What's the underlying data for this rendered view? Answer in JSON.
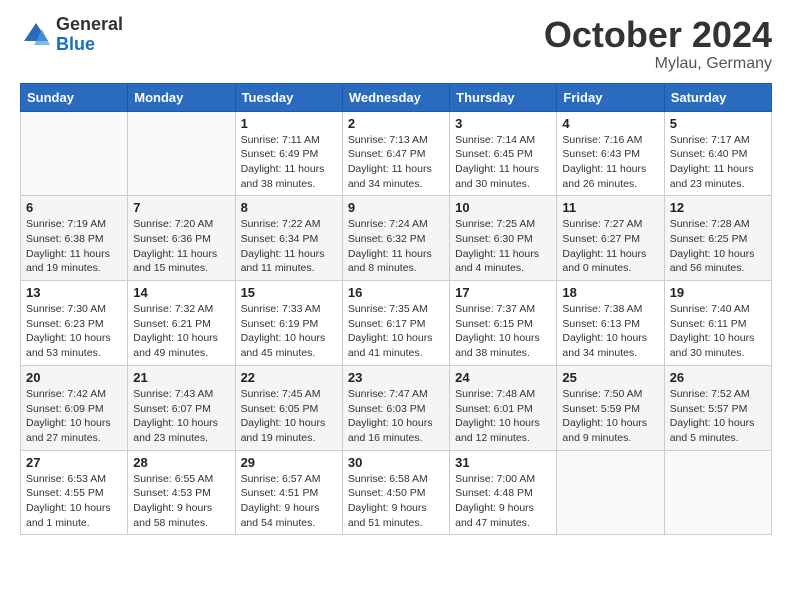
{
  "logo": {
    "general": "General",
    "blue": "Blue"
  },
  "title": "October 2024",
  "subtitle": "Mylau, Germany",
  "weekdays": [
    "Sunday",
    "Monday",
    "Tuesday",
    "Wednesday",
    "Thursday",
    "Friday",
    "Saturday"
  ],
  "weeks": [
    [
      {
        "day": "",
        "sunrise": "",
        "sunset": "",
        "daylight": ""
      },
      {
        "day": "",
        "sunrise": "",
        "sunset": "",
        "daylight": ""
      },
      {
        "day": "1",
        "sunrise": "Sunrise: 7:11 AM",
        "sunset": "Sunset: 6:49 PM",
        "daylight": "Daylight: 11 hours and 38 minutes."
      },
      {
        "day": "2",
        "sunrise": "Sunrise: 7:13 AM",
        "sunset": "Sunset: 6:47 PM",
        "daylight": "Daylight: 11 hours and 34 minutes."
      },
      {
        "day": "3",
        "sunrise": "Sunrise: 7:14 AM",
        "sunset": "Sunset: 6:45 PM",
        "daylight": "Daylight: 11 hours and 30 minutes."
      },
      {
        "day": "4",
        "sunrise": "Sunrise: 7:16 AM",
        "sunset": "Sunset: 6:43 PM",
        "daylight": "Daylight: 11 hours and 26 minutes."
      },
      {
        "day": "5",
        "sunrise": "Sunrise: 7:17 AM",
        "sunset": "Sunset: 6:40 PM",
        "daylight": "Daylight: 11 hours and 23 minutes."
      }
    ],
    [
      {
        "day": "6",
        "sunrise": "Sunrise: 7:19 AM",
        "sunset": "Sunset: 6:38 PM",
        "daylight": "Daylight: 11 hours and 19 minutes."
      },
      {
        "day": "7",
        "sunrise": "Sunrise: 7:20 AM",
        "sunset": "Sunset: 6:36 PM",
        "daylight": "Daylight: 11 hours and 15 minutes."
      },
      {
        "day": "8",
        "sunrise": "Sunrise: 7:22 AM",
        "sunset": "Sunset: 6:34 PM",
        "daylight": "Daylight: 11 hours and 11 minutes."
      },
      {
        "day": "9",
        "sunrise": "Sunrise: 7:24 AM",
        "sunset": "Sunset: 6:32 PM",
        "daylight": "Daylight: 11 hours and 8 minutes."
      },
      {
        "day": "10",
        "sunrise": "Sunrise: 7:25 AM",
        "sunset": "Sunset: 6:30 PM",
        "daylight": "Daylight: 11 hours and 4 minutes."
      },
      {
        "day": "11",
        "sunrise": "Sunrise: 7:27 AM",
        "sunset": "Sunset: 6:27 PM",
        "daylight": "Daylight: 11 hours and 0 minutes."
      },
      {
        "day": "12",
        "sunrise": "Sunrise: 7:28 AM",
        "sunset": "Sunset: 6:25 PM",
        "daylight": "Daylight: 10 hours and 56 minutes."
      }
    ],
    [
      {
        "day": "13",
        "sunrise": "Sunrise: 7:30 AM",
        "sunset": "Sunset: 6:23 PM",
        "daylight": "Daylight: 10 hours and 53 minutes."
      },
      {
        "day": "14",
        "sunrise": "Sunrise: 7:32 AM",
        "sunset": "Sunset: 6:21 PM",
        "daylight": "Daylight: 10 hours and 49 minutes."
      },
      {
        "day": "15",
        "sunrise": "Sunrise: 7:33 AM",
        "sunset": "Sunset: 6:19 PM",
        "daylight": "Daylight: 10 hours and 45 minutes."
      },
      {
        "day": "16",
        "sunrise": "Sunrise: 7:35 AM",
        "sunset": "Sunset: 6:17 PM",
        "daylight": "Daylight: 10 hours and 41 minutes."
      },
      {
        "day": "17",
        "sunrise": "Sunrise: 7:37 AM",
        "sunset": "Sunset: 6:15 PM",
        "daylight": "Daylight: 10 hours and 38 minutes."
      },
      {
        "day": "18",
        "sunrise": "Sunrise: 7:38 AM",
        "sunset": "Sunset: 6:13 PM",
        "daylight": "Daylight: 10 hours and 34 minutes."
      },
      {
        "day": "19",
        "sunrise": "Sunrise: 7:40 AM",
        "sunset": "Sunset: 6:11 PM",
        "daylight": "Daylight: 10 hours and 30 minutes."
      }
    ],
    [
      {
        "day": "20",
        "sunrise": "Sunrise: 7:42 AM",
        "sunset": "Sunset: 6:09 PM",
        "daylight": "Daylight: 10 hours and 27 minutes."
      },
      {
        "day": "21",
        "sunrise": "Sunrise: 7:43 AM",
        "sunset": "Sunset: 6:07 PM",
        "daylight": "Daylight: 10 hours and 23 minutes."
      },
      {
        "day": "22",
        "sunrise": "Sunrise: 7:45 AM",
        "sunset": "Sunset: 6:05 PM",
        "daylight": "Daylight: 10 hours and 19 minutes."
      },
      {
        "day": "23",
        "sunrise": "Sunrise: 7:47 AM",
        "sunset": "Sunset: 6:03 PM",
        "daylight": "Daylight: 10 hours and 16 minutes."
      },
      {
        "day": "24",
        "sunrise": "Sunrise: 7:48 AM",
        "sunset": "Sunset: 6:01 PM",
        "daylight": "Daylight: 10 hours and 12 minutes."
      },
      {
        "day": "25",
        "sunrise": "Sunrise: 7:50 AM",
        "sunset": "Sunset: 5:59 PM",
        "daylight": "Daylight: 10 hours and 9 minutes."
      },
      {
        "day": "26",
        "sunrise": "Sunrise: 7:52 AM",
        "sunset": "Sunset: 5:57 PM",
        "daylight": "Daylight: 10 hours and 5 minutes."
      }
    ],
    [
      {
        "day": "27",
        "sunrise": "Sunrise: 6:53 AM",
        "sunset": "Sunset: 4:55 PM",
        "daylight": "Daylight: 10 hours and 1 minute."
      },
      {
        "day": "28",
        "sunrise": "Sunrise: 6:55 AM",
        "sunset": "Sunset: 4:53 PM",
        "daylight": "Daylight: 9 hours and 58 minutes."
      },
      {
        "day": "29",
        "sunrise": "Sunrise: 6:57 AM",
        "sunset": "Sunset: 4:51 PM",
        "daylight": "Daylight: 9 hours and 54 minutes."
      },
      {
        "day": "30",
        "sunrise": "Sunrise: 6:58 AM",
        "sunset": "Sunset: 4:50 PM",
        "daylight": "Daylight: 9 hours and 51 minutes."
      },
      {
        "day": "31",
        "sunrise": "Sunrise: 7:00 AM",
        "sunset": "Sunset: 4:48 PM",
        "daylight": "Daylight: 9 hours and 47 minutes."
      },
      {
        "day": "",
        "sunrise": "",
        "sunset": "",
        "daylight": ""
      },
      {
        "day": "",
        "sunrise": "",
        "sunset": "",
        "daylight": ""
      }
    ]
  ]
}
